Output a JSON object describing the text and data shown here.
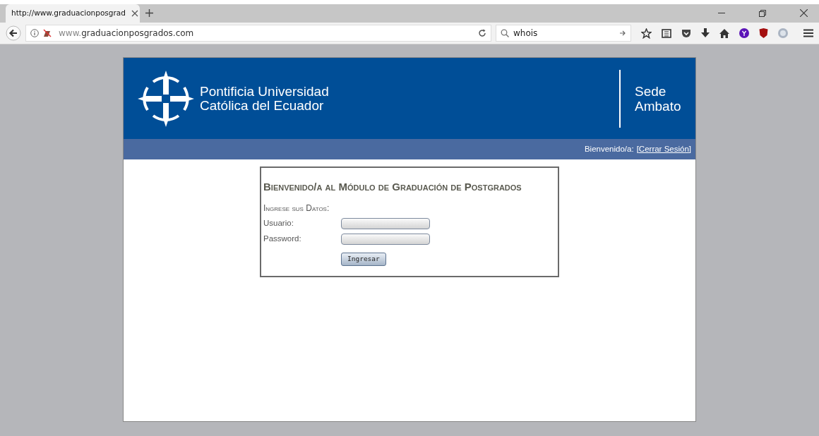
{
  "browser": {
    "tab": {
      "title": "http://www.graduacionposgrad",
      "selected": true
    },
    "url": {
      "prefix": "www.",
      "domain": "graduacionposgrados.com"
    },
    "search": {
      "value": "whois"
    }
  },
  "header": {
    "university": [
      "Pontificia Universidad",
      "Católica del Ecuador"
    ],
    "campus": [
      "Sede",
      "Ambato"
    ]
  },
  "session_bar": {
    "greeting": "Bienvenido/a:",
    "logout": "[Cerrar Sesión]"
  },
  "login": {
    "title": "Bienvenido/a al Módulo de Graduación de Postgrados",
    "subtitle": "Ingrese sus Datos:",
    "fields": [
      {
        "label": "Usuario:"
      },
      {
        "label": "Password:"
      }
    ],
    "button": "Ingresar"
  }
}
